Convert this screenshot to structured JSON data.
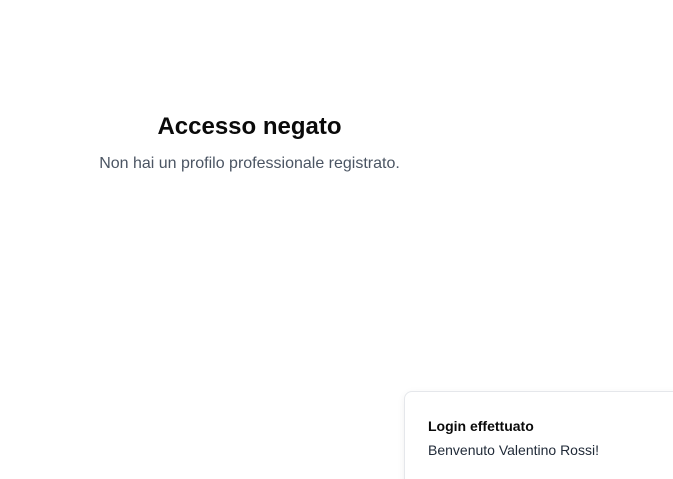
{
  "main": {
    "title": "Accesso negato",
    "message": "Non hai un profilo professionale registrato."
  },
  "toast": {
    "title": "Login effettuato",
    "description": "Benvenuto Valentino Rossi!"
  },
  "colors": {
    "background": "#ffffff",
    "title_text": "#0a0a0a",
    "message_text": "#4b5563",
    "toast_border": "#e5e7eb"
  }
}
